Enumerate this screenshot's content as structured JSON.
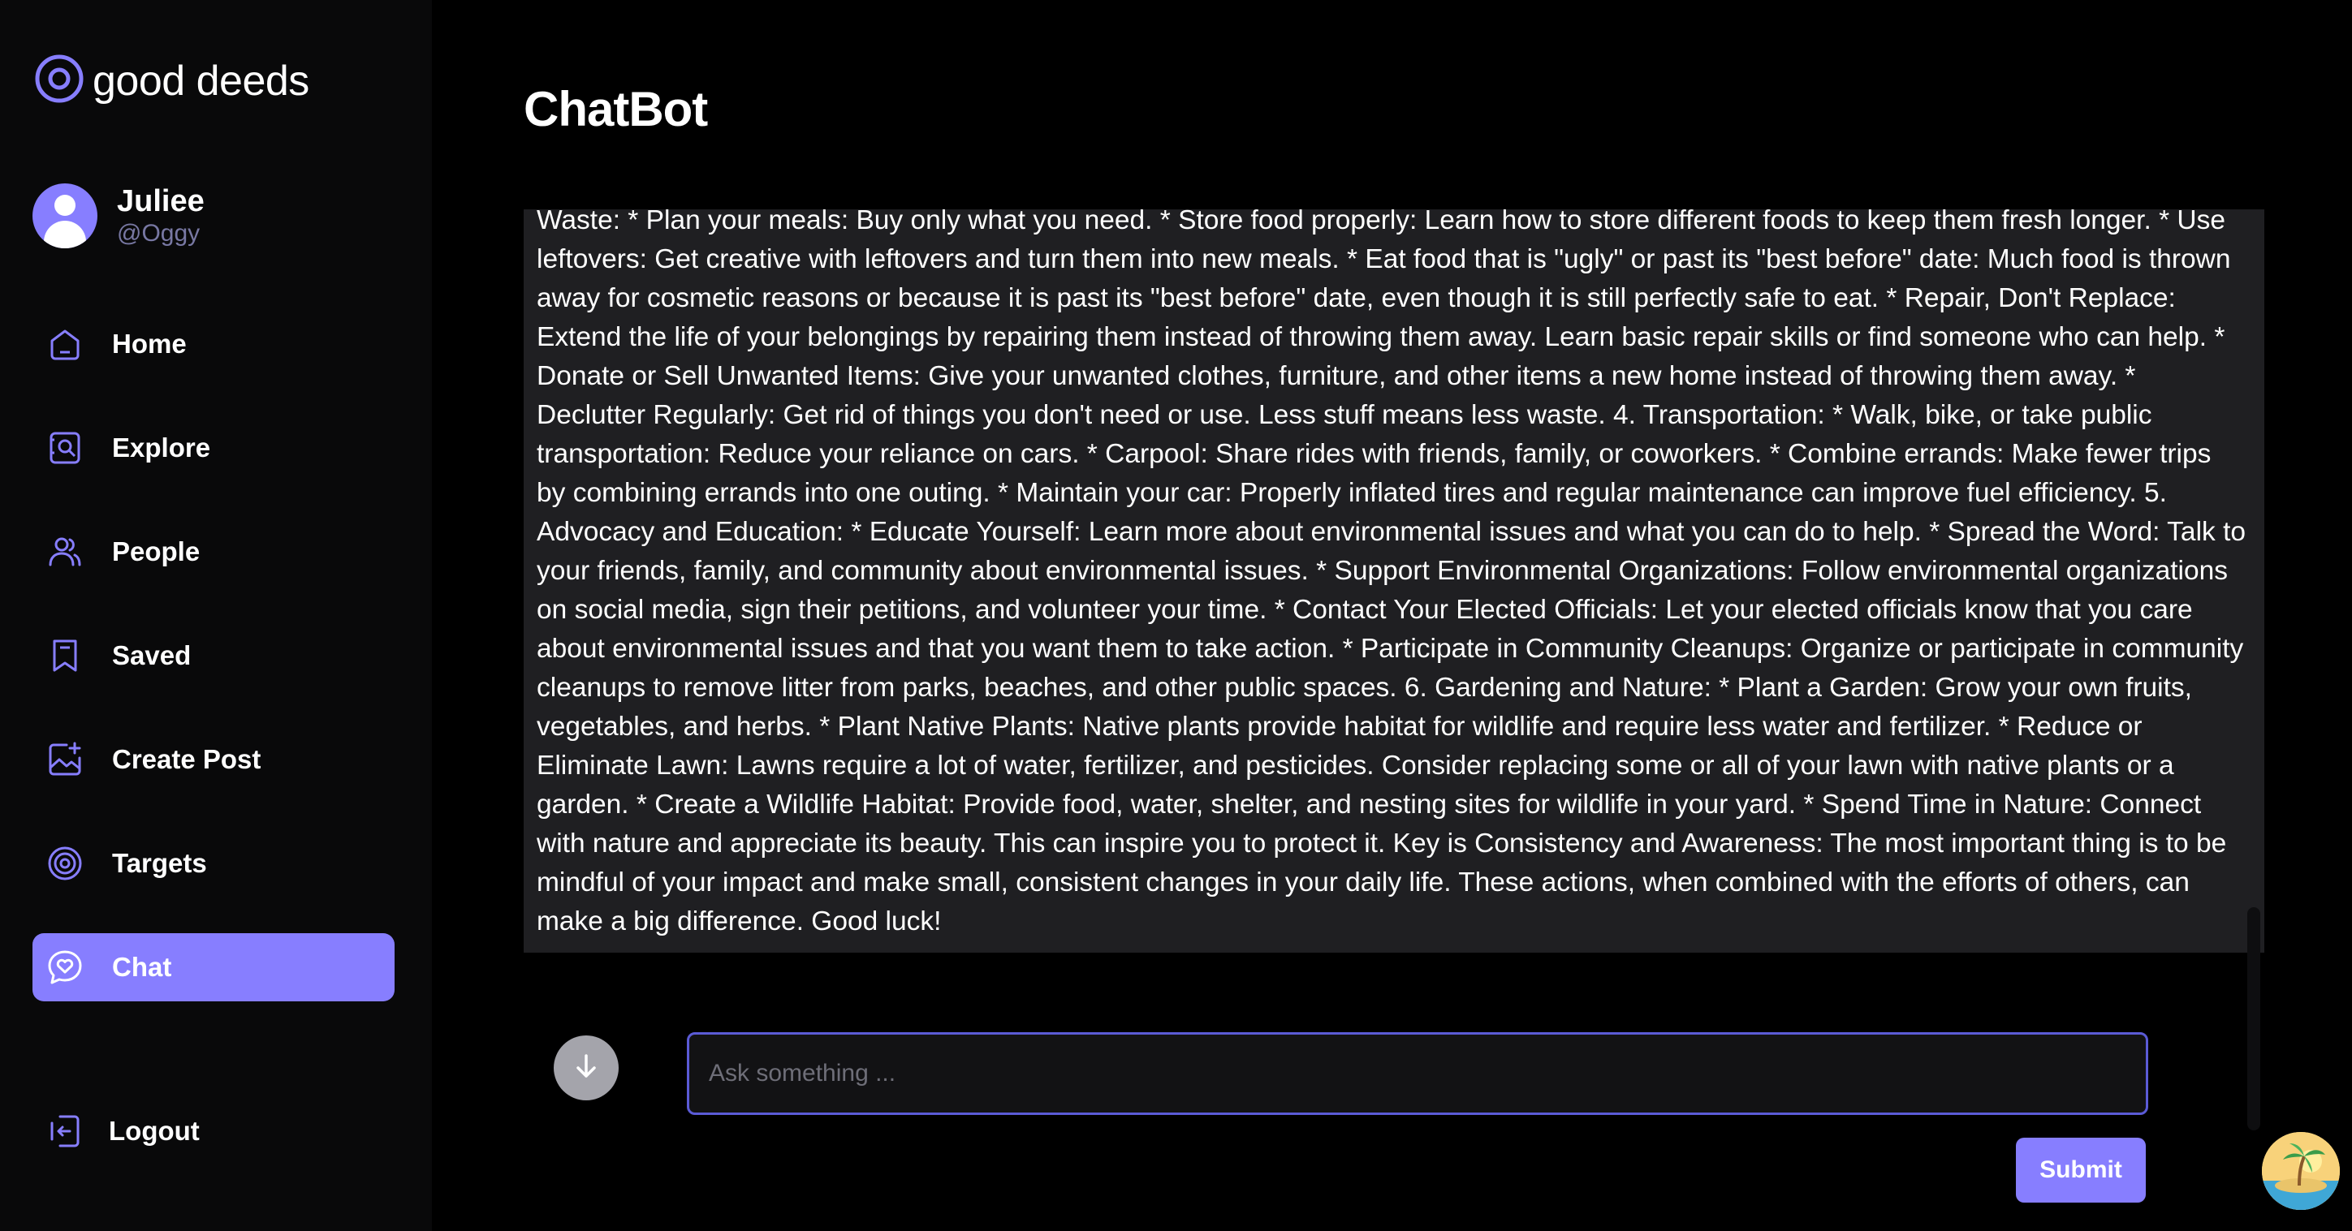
{
  "brand": {
    "name": "good deeds",
    "accent": "#877eff"
  },
  "user": {
    "name": "Juliee",
    "handle": "@Oggy"
  },
  "nav": {
    "items": [
      {
        "label": "Home",
        "icon": "home-icon"
      },
      {
        "label": "Explore",
        "icon": "explore-icon"
      },
      {
        "label": "People",
        "icon": "people-icon"
      },
      {
        "label": "Saved",
        "icon": "bookmark-icon"
      },
      {
        "label": "Create Post",
        "icon": "create-post-icon"
      },
      {
        "label": "Targets",
        "icon": "target-icon"
      },
      {
        "label": "Chat",
        "icon": "chat-heart-icon",
        "active": true
      }
    ],
    "logout": "Logout"
  },
  "main": {
    "title": "ChatBot",
    "message": "Waste: * Plan your meals: Buy only what you need. * Store food properly: Learn how to store different foods to keep them fresh longer. * Use leftovers: Get creative with leftovers and turn them into new meals. * Eat food that is \"ugly\" or past its \"best before\" date: Much food is thrown away for cosmetic reasons or because it is past its \"best before\" date, even though it is still perfectly safe to eat. * Repair, Don't Replace: Extend the life of your belongings by repairing them instead of throwing them away. Learn basic repair skills or find someone who can help. * Donate or Sell Unwanted Items: Give your unwanted clothes, furniture, and other items a new home instead of throwing them away. * Declutter Regularly: Get rid of things you don't need or use. Less stuff means less waste. 4. Transportation: * Walk, bike, or take public transportation: Reduce your reliance on cars. * Carpool: Share rides with friends, family, or coworkers. * Combine errands: Make fewer trips by combining errands into one outing. * Maintain your car: Properly inflated tires and regular maintenance can improve fuel efficiency. 5. Advocacy and Education: * Educate Yourself: Learn more about environmental issues and what you can do to help. * Spread the Word: Talk to your friends, family, and community about environmental issues. * Support Environmental Organizations: Follow environmental organizations on social media, sign their petitions, and volunteer your time. * Contact Your Elected Officials: Let your elected officials know that you care about environmental issues and that you want them to take action. * Participate in Community Cleanups: Organize or participate in community cleanups to remove litter from parks, beaches, and other public spaces. 6. Gardening and Nature: * Plant a Garden: Grow your own fruits, vegetables, and herbs. * Plant Native Plants: Native plants provide habitat for wildlife and require less water and fertilizer. * Reduce or Eliminate Lawn: Lawns require a lot of water, fertilizer, and pesticides. Consider replacing some or all of your lawn with native plants or a garden. * Create a Wildlife Habitat: Provide food, water, shelter, and nesting sites for wildlife in your yard. * Spend Time in Nature: Connect with nature and appreciate its beauty. This can inspire you to protect it. Key is Consistency and Awareness: The most important thing is to be mindful of your impact and make small, consistent changes in your daily life. These actions, when combined with the efforts of others, can make a big difference. Good luck!",
    "input": {
      "placeholder": "Ask something ...",
      "value": ""
    },
    "submit_label": "Submit",
    "scroll_down_icon": "arrow-down-icon",
    "fab_icon": "beach-island-icon"
  }
}
